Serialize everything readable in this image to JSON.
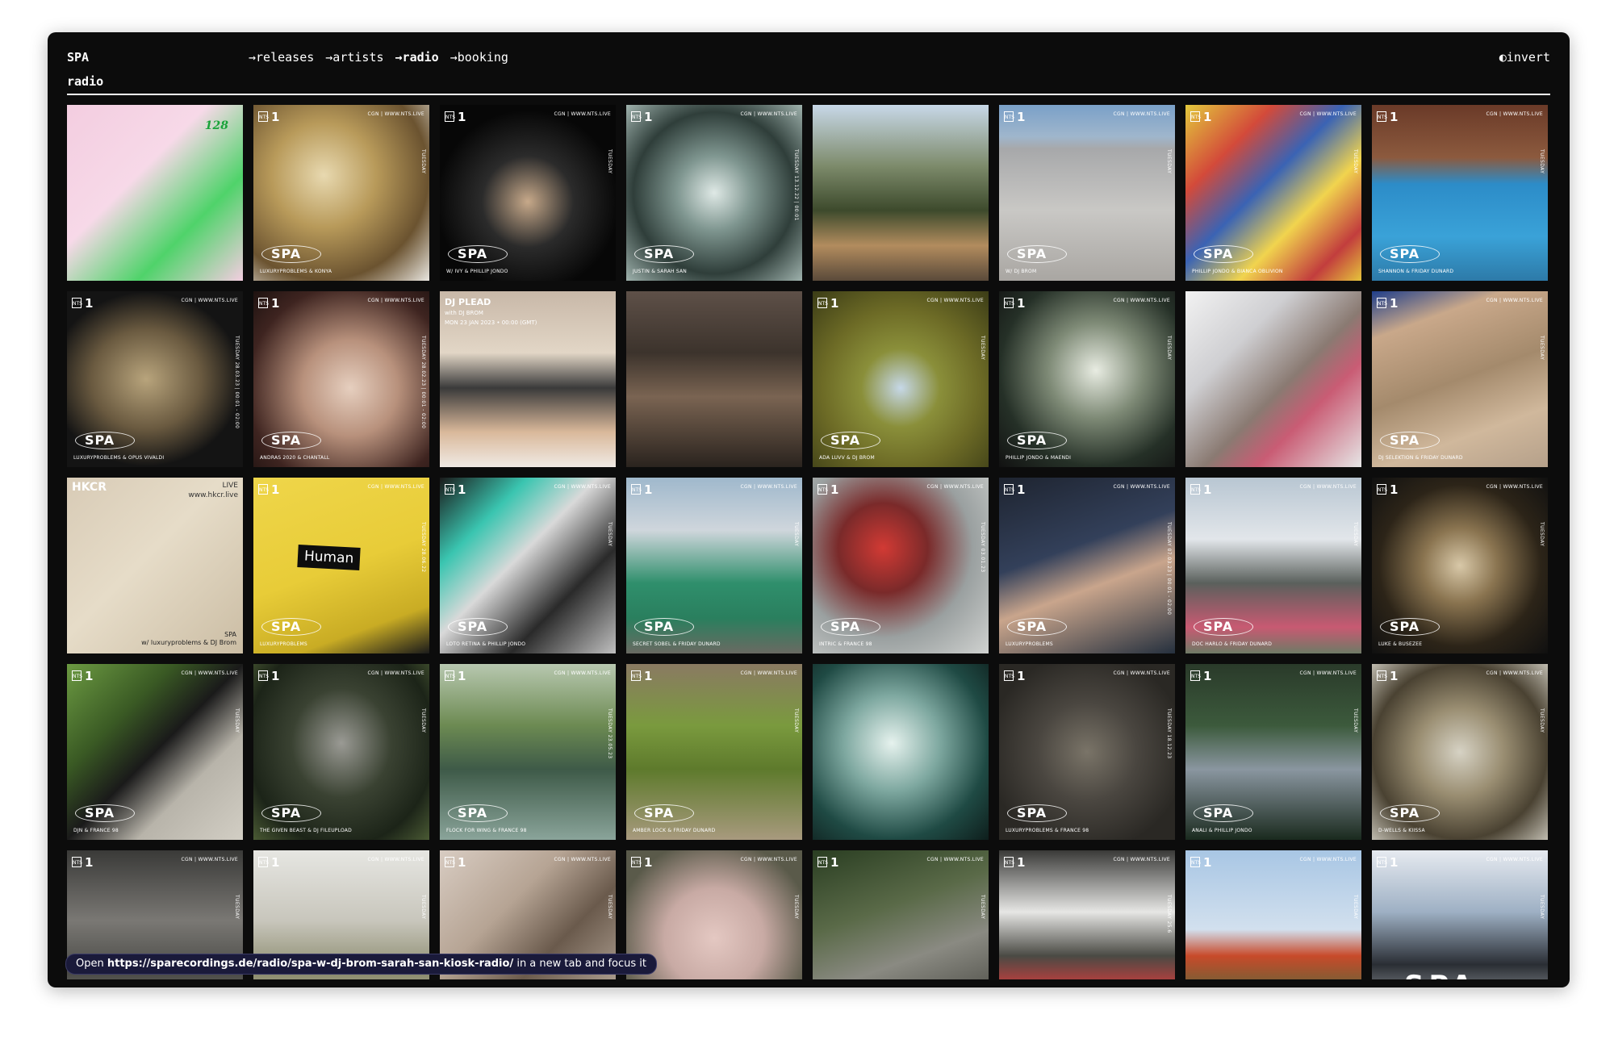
{
  "header": {
    "logo": "SPA",
    "nav": [
      {
        "label": "→releases",
        "active": false
      },
      {
        "label": "→artists",
        "active": false
      },
      {
        "label": "→radio",
        "active": true
      },
      {
        "label": "→booking",
        "active": false
      }
    ],
    "invert_label": "◐invert"
  },
  "page_title": "radio",
  "tiles": [
    {
      "art": "grad-green-pink",
      "special": "kiosk"
    },
    {
      "art": "grad-glass",
      "caption": "LUXURYPROBLEMS & KONYA",
      "side": "TUESDAY"
    },
    {
      "art": "grad-blue-dark",
      "caption": "W/ IVY & PHILLIP JONDO",
      "side": "TUESDAY"
    },
    {
      "art": "grad-water",
      "caption": "JUSTIN & SARAH SAN",
      "side": "TUESDAY 13.12.22 | 00:01"
    },
    {
      "art": "grad-park",
      "special": "photo"
    },
    {
      "art": "grad-concrete",
      "caption": "W/ DJ BROM",
      "side": "TUESDAY"
    },
    {
      "art": "grad-toys",
      "caption": "PHILLIP JONDO & BIANCA OBLIVION",
      "side": "TUESDAY"
    },
    {
      "art": "grad-pool",
      "caption": "SHANNON & FRIDAY DUNARD",
      "side": "TUESDAY"
    },
    {
      "art": "grad-mona",
      "caption": "LUXURYPROBLEMS & OPUS VIVALDI",
      "side": "TUESDAY 28.03.23 | 00:01 - 02:00"
    },
    {
      "art": "grad-body",
      "caption": "ANDRAS 2020 & CHANTALL",
      "side": "TUESDAY 28.02.23 | 00:01 - 02:00"
    },
    {
      "art": "grad-diner",
      "special": "plead",
      "plead_title": "DJ PLEAD",
      "plead_with": "with DJ BROM",
      "plead_date": "MON 23 JAN 2023 • 00:00 (GMT)"
    },
    {
      "art": "grad-crowd",
      "special": "photo"
    },
    {
      "art": "grad-moss",
      "caption": "ADA LUVV & DJ BROM",
      "side": "TUESDAY"
    },
    {
      "art": "grad-chandelier",
      "caption": "PHILLIP JONDO & MAENDI",
      "side": "TUESDAY"
    },
    {
      "art": "grad-teddy",
      "special": "photo"
    },
    {
      "art": "grad-carpet",
      "caption": "DJ SELEKTION & FRIDAY DUNARD",
      "side": "TUESDAY"
    },
    {
      "art": "grad-wall",
      "special": "hckr",
      "hckr_title": "HKCR",
      "hckr_live": "LIVE",
      "hckr_site": "www.hkcr.live",
      "hckr_foot": "SPA",
      "hckr_sub": "w/ luxuryproblems & DJ Brom"
    },
    {
      "art": "grad-yellow",
      "special": "human",
      "human_label": "Human",
      "caption": "LUXURYPROBLEMS",
      "side": "TUESDAY 28.06.22"
    },
    {
      "art": "grad-graffiti",
      "caption": "LOTO RETINA & PHILLIP JONDO",
      "side": "TUESDAY"
    },
    {
      "art": "grad-court",
      "caption": "SECRET SOBEL & FRIDAY DUNARD",
      "side": "TUESDAY"
    },
    {
      "art": "grad-berries",
      "caption": "INTRIC & FRANCE 98",
      "side": "TUESDAY 03.01.23"
    },
    {
      "art": "grad-watch",
      "caption": "LUXURYPROBLEMS",
      "side": "TUESDAY 07.03.23 | 00:01 - 02:00"
    },
    {
      "art": "grad-statue",
      "caption": "DOC HARLO & FRIDAY DUNARD",
      "side": "TUESDAY"
    },
    {
      "art": "grad-branches",
      "caption": "LUKE & BUSEZEE",
      "side": "TUESDAY"
    },
    {
      "art": "grad-asphalt",
      "caption": "DJN & FRANCE 98",
      "side": "TUESDAY"
    },
    {
      "art": "grad-alien",
      "caption": "THE GIVEN BEAST & DJ FILEUPLOAD",
      "side": "TUESDAY"
    },
    {
      "art": "grad-stream",
      "caption": "FLOCK FOR WING & FRANCE 98",
      "side": "TUESDAY 23.05.23"
    },
    {
      "art": "grad-mossrock",
      "caption": "AMBER LOCK & FRIDAY DUNARD",
      "side": "TUESDAY"
    },
    {
      "art": "grad-insect",
      "special": "photo"
    },
    {
      "art": "grad-mud",
      "caption": "LUXURYPROBLEMS & FRANCE 98",
      "side": "TUESDAY 18.12.23"
    },
    {
      "art": "grad-fence",
      "caption": "ANALI & PHILLIP JONDO",
      "side": "TUESDAY"
    },
    {
      "art": "grad-web",
      "caption": "D-WELLS & KIISSA",
      "side": "TUESDAY"
    },
    {
      "art": "grad-rocks",
      "side": "TUESDAY"
    },
    {
      "art": "grad-foggy",
      "side": "TUESDAY"
    },
    {
      "art": "grad-plants",
      "side": "TUESDAY"
    },
    {
      "art": "grad-leaf",
      "side": "TUESDAY"
    },
    {
      "art": "grad-grate",
      "side": "TUESDAY"
    },
    {
      "art": "grad-snow",
      "side": "TUESDAY 25.6"
    },
    {
      "art": "grad-orange",
      "side": "TUESDAY"
    },
    {
      "art": "grad-sky",
      "special": "spa-big",
      "side": "TUESDAY"
    }
  ],
  "nts_mark": "NTS",
  "nts_number": "1",
  "cgn_text": "CGN | WWW.NTS.LIVE",
  "spa_text": "SPA",
  "statusbar": {
    "prefix": "Open",
    "url": "https://sparecordings.de/radio/spa-w-dj-brom-sarah-san-kiosk-radio/",
    "suffix": "in a new tab and focus it"
  }
}
